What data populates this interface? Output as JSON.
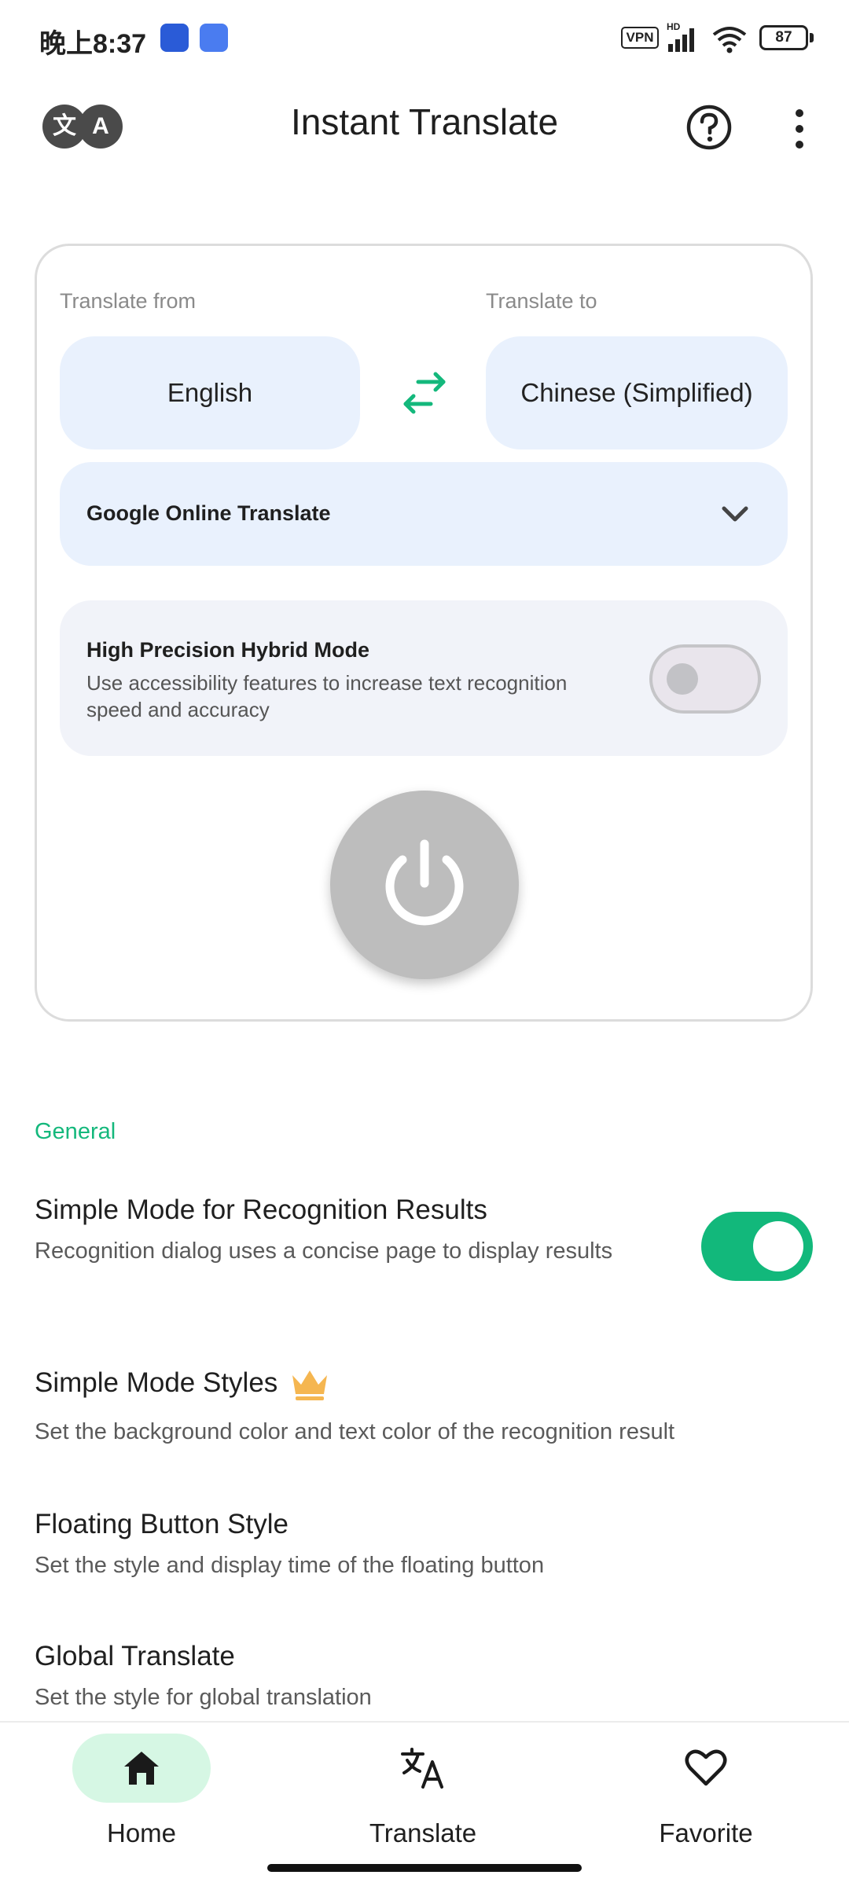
{
  "status_bar": {
    "time": "晚上8:37",
    "vpn": "VPN",
    "network": "HD",
    "battery": "87"
  },
  "app_bar": {
    "logo_chars": [
      "文",
      "A"
    ],
    "title": "Instant Translate",
    "icons": [
      "help-icon",
      "more-vert-icon"
    ]
  },
  "translate_card": {
    "from_label": "Translate from",
    "to_label": "Translate to",
    "from_language": "English",
    "to_language": "Chinese (Simplified)",
    "engine": "Google Online Translate",
    "hybrid_mode": {
      "title": "High Precision Hybrid Mode",
      "description": "Use accessibility features to increase text recognition speed and accuracy",
      "enabled": false
    },
    "power_state": "off"
  },
  "settings": {
    "section_title": "General",
    "items": [
      {
        "title": "Simple Mode for Recognition Results",
        "description": "Recognition dialog uses a concise page to display results",
        "toggle": true
      },
      {
        "title": "Simple Mode Styles",
        "description": "Set the background color and text color of the recognition result",
        "premium": true
      },
      {
        "title": "Floating Button Style",
        "description": "Set the style and display time of the floating button"
      },
      {
        "title": "Global Translate",
        "description": "Set the style for global translation"
      }
    ]
  },
  "bottom_nav": {
    "items": [
      {
        "label": "Home",
        "icon": "home-icon",
        "selected": true
      },
      {
        "label": "Translate",
        "icon": "translate-icon",
        "selected": false
      },
      {
        "label": "Favorite",
        "icon": "heart-icon",
        "selected": false
      }
    ]
  },
  "colors": {
    "accent_green": "#12b87b",
    "pill_blue": "#e9f1fd",
    "premium_gold": "#f5b650"
  }
}
